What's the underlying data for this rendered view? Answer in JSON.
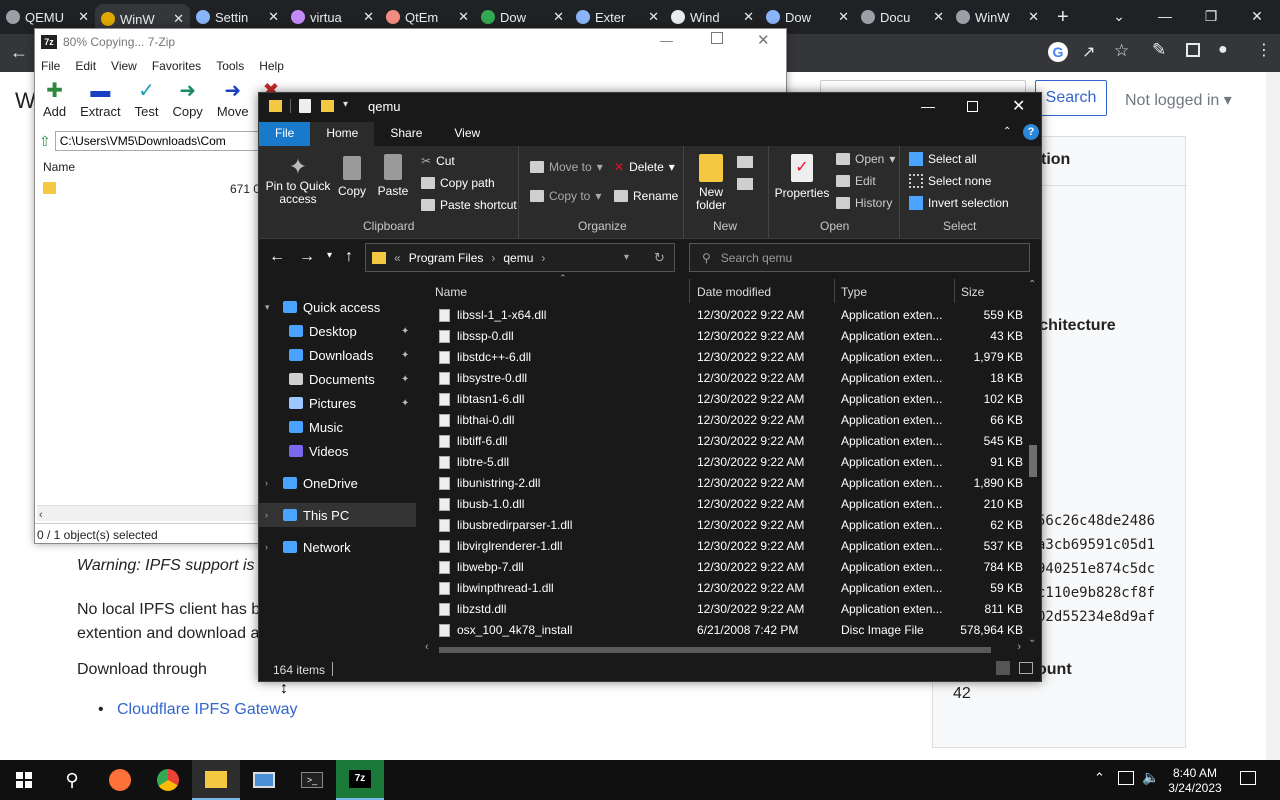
{
  "chrome": {
    "tabs": [
      {
        "label": "QEMU",
        "icon": "globe-icon",
        "color": "#9aa0a6"
      },
      {
        "label": "WinW",
        "icon": "w-icon",
        "color": "#e0a800",
        "active": true
      },
      {
        "label": "Settin",
        "icon": "gear-icon",
        "color": "#8ab4f8"
      },
      {
        "label": "virtua",
        "icon": "github-icon",
        "color": "#c58af9"
      },
      {
        "label": "QtEm",
        "icon": "diamond-icon",
        "color": "#f28b82"
      },
      {
        "label": "Dow",
        "icon": "flag-icon",
        "color": "#34a853"
      },
      {
        "label": "Exter",
        "icon": "puzzle-icon",
        "color": "#8ab4f8"
      },
      {
        "label": "Wind",
        "icon": "building-icon",
        "color": "#e8eaed"
      },
      {
        "label": "Dow",
        "icon": "download-icon",
        "color": "#8ab4f8"
      },
      {
        "label": "Docu",
        "icon": "globe-icon",
        "color": "#9aa0a6"
      },
      {
        "label": "WinW",
        "icon": "globe-icon",
        "color": "#9aa0a6"
      }
    ],
    "page": {
      "title_letter": "W",
      "search_label": "Search",
      "not_logged_in": "Not logged in",
      "section_partial": "tion",
      "architecture": "rchitecture",
      "hashes": [
        "56c26c48de2486",
        "a3cb69591c05d1",
        "940251e874c5dc",
        "c110e9b828cf8f",
        "02d55234e8d9af"
      ],
      "count_label": "ount",
      "count_value": "42",
      "warning": "Warning: IPFS support is c",
      "no_local": "No local IPFS client has be",
      "extention": "extention and download a",
      "download_through": "Download through",
      "gateway_link": "Cloudflare IPFS Gateway"
    }
  },
  "sevenzip": {
    "title": "80% Copying... 7-Zip",
    "menu": [
      "File",
      "Edit",
      "View",
      "Favorites",
      "Tools",
      "Help"
    ],
    "toolbar": [
      "Add",
      "Extract",
      "Test",
      "Copy",
      "Move",
      "D"
    ],
    "path": "C:\\Users\\VM5\\Downloads\\Com",
    "col_name": "Name",
    "file_size": "671 0",
    "status": "0 / 1 object(s) selected"
  },
  "explorer": {
    "title": "qemu",
    "ribbon_tabs": [
      "File",
      "Home",
      "Share",
      "View"
    ],
    "clipboard": {
      "pin": "Pin to Quick access",
      "copy": "Copy",
      "paste": "Paste",
      "cut": "Cut",
      "copy_path": "Copy path",
      "paste_shortcut": "Paste shortcut",
      "label": "Clipboard"
    },
    "organize": {
      "move_to": "Move to",
      "copy_to": "Copy to",
      "delete": "Delete",
      "rename": "Rename",
      "label": "Organize"
    },
    "new": {
      "new_folder": "New folder",
      "label": "New"
    },
    "open": {
      "properties": "Properties",
      "open": "Open",
      "edit": "Edit",
      "history": "History",
      "label": "Open"
    },
    "select": {
      "all": "Select all",
      "none": "Select none",
      "invert": "Invert selection",
      "label": "Select"
    },
    "address": {
      "root": "Program Files",
      "folder": "qemu",
      "search_placeholder": "Search qemu"
    },
    "nav": [
      {
        "label": "Quick access",
        "icon": "star-icon",
        "indent": 0
      },
      {
        "label": "Desktop",
        "icon": "desktop-icon",
        "indent": 1,
        "pin": true
      },
      {
        "label": "Downloads",
        "icon": "download-icon",
        "indent": 1,
        "pin": true
      },
      {
        "label": "Documents",
        "icon": "document-icon",
        "indent": 1,
        "pin": true
      },
      {
        "label": "Pictures",
        "icon": "picture-icon",
        "indent": 1,
        "pin": true
      },
      {
        "label": "Music",
        "icon": "music-icon",
        "indent": 1
      },
      {
        "label": "Videos",
        "icon": "video-icon",
        "indent": 1
      },
      {
        "label": "OneDrive",
        "icon": "cloud-icon",
        "indent": 0
      },
      {
        "label": "This PC",
        "icon": "computer-icon",
        "indent": 0,
        "selected": true
      },
      {
        "label": "Network",
        "icon": "network-icon",
        "indent": 0
      }
    ],
    "columns": {
      "name": "Name",
      "date": "Date modified",
      "type": "Type",
      "size": "Size"
    },
    "files": [
      [
        "libssl-1_1-x64.dll",
        "12/30/2022 9:22 AM",
        "Application exten...",
        "559 KB"
      ],
      [
        "libssp-0.dll",
        "12/30/2022 9:22 AM",
        "Application exten...",
        "43 KB"
      ],
      [
        "libstdc++-6.dll",
        "12/30/2022 9:22 AM",
        "Application exten...",
        "1,979 KB"
      ],
      [
        "libsystre-0.dll",
        "12/30/2022 9:22 AM",
        "Application exten...",
        "18 KB"
      ],
      [
        "libtasn1-6.dll",
        "12/30/2022 9:22 AM",
        "Application exten...",
        "102 KB"
      ],
      [
        "libthai-0.dll",
        "12/30/2022 9:22 AM",
        "Application exten...",
        "66 KB"
      ],
      [
        "libtiff-6.dll",
        "12/30/2022 9:22 AM",
        "Application exten...",
        "545 KB"
      ],
      [
        "libtre-5.dll",
        "12/30/2022 9:22 AM",
        "Application exten...",
        "91 KB"
      ],
      [
        "libunistring-2.dll",
        "12/30/2022 9:22 AM",
        "Application exten...",
        "1,890 KB"
      ],
      [
        "libusb-1.0.dll",
        "12/30/2022 9:22 AM",
        "Application exten...",
        "210 KB"
      ],
      [
        "libusbredirparser-1.dll",
        "12/30/2022 9:22 AM",
        "Application exten...",
        "62 KB"
      ],
      [
        "libvirglrenderer-1.dll",
        "12/30/2022 9:22 AM",
        "Application exten...",
        "537 KB"
      ],
      [
        "libwebp-7.dll",
        "12/30/2022 9:22 AM",
        "Application exten...",
        "784 KB"
      ],
      [
        "libwinpthread-1.dll",
        "12/30/2022 9:22 AM",
        "Application exten...",
        "59 KB"
      ],
      [
        "libzstd.dll",
        "12/30/2022 9:22 AM",
        "Application exten...",
        "811 KB"
      ],
      [
        "osx_100_4k78_install",
        "6/21/2008 7:42 PM",
        "Disc Image File",
        "578,964 KB"
      ]
    ],
    "status": "164 items"
  },
  "taskbar": {
    "time": "8:40 AM",
    "date": "3/24/2023"
  }
}
